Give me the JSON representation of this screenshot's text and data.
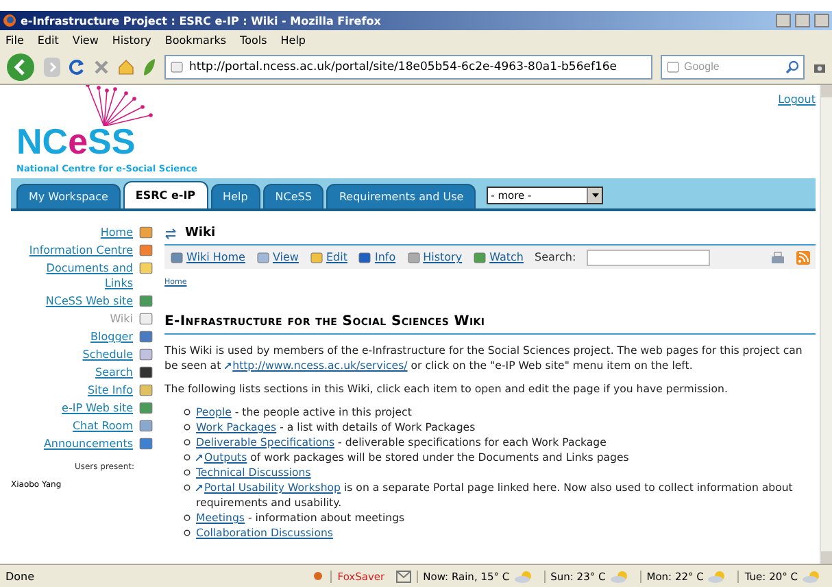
{
  "window": {
    "title": "e-Infrastructure Project : ESRC e-IP : Wiki - Mozilla Firefox"
  },
  "menu": [
    "File",
    "Edit",
    "View",
    "History",
    "Bookmarks",
    "Tools",
    "Help"
  ],
  "nav": {
    "url": "http://portal.ncess.ac.uk/portal/site/18e05b54-6c2e-4963-80a1-b56ef16e",
    "search": {
      "placeholder": "Google"
    }
  },
  "header": {
    "logout": "Logout",
    "logo": [
      {
        "text": "NC",
        "color": "#1aa6dc"
      },
      {
        "text": "e",
        "color": "#d21b82"
      },
      {
        "text": "SS",
        "color": "#1aa6dc"
      }
    ],
    "tagline": "National Centre for e-Social Science"
  },
  "tabs": [
    {
      "label": "My Workspace",
      "selected": false
    },
    {
      "label": "ESRC e-IP",
      "selected": true
    },
    {
      "label": "Help",
      "selected": false
    },
    {
      "label": "NCeSS",
      "selected": false
    },
    {
      "label": "Requirements and Use",
      "selected": false
    }
  ],
  "more": {
    "value": "- more -"
  },
  "sidebar": {
    "items": [
      {
        "label": "Home",
        "selected": false
      },
      {
        "label": "Information Centre",
        "selected": false
      },
      {
        "label": "Documents and Links",
        "selected": false
      },
      {
        "label": "NCeSS Web site",
        "selected": false
      },
      {
        "label": "Wiki",
        "selected": true
      },
      {
        "label": "Blogger",
        "selected": false
      },
      {
        "label": "Schedule",
        "selected": false
      },
      {
        "label": "Search",
        "selected": false
      },
      {
        "label": "Site Info",
        "selected": false
      },
      {
        "label": "e-IP Web site",
        "selected": false
      },
      {
        "label": "Chat Room",
        "selected": false
      },
      {
        "label": "Announcements",
        "selected": false
      }
    ],
    "users_label": "Users present:",
    "users": [
      "Xiaobo Yang"
    ]
  },
  "wiki": {
    "title": "Wiki",
    "toolbar": [
      "Wiki Home",
      "View",
      "Edit",
      "Info",
      "History",
      "Watch"
    ],
    "search_label": "Search:",
    "breadcrumb": "Home",
    "heading": "E-Infrastructure for the Social Sciences Wiki",
    "intro": {
      "before": "This Wiki is used by members of the e-Infrastructure for the Social Sciences project. The web pages for this project can be seen at ",
      "link": "http://www.ncess.ac.uk/services/",
      "after": " or click on the \"e-IP Web site\" menu item on the left."
    },
    "lead": "The following lists sections in this Wiki, click each item to open and edit the page if you have permission.",
    "items": [
      {
        "link": "People",
        "text": " - the people active in this project",
        "external": false
      },
      {
        "link": "Work Packages",
        "text": " - a list with details of Work Packages",
        "external": false
      },
      {
        "link": "Deliverable Specifications",
        "text": " - deliverable specifications for each Work Package",
        "external": false
      },
      {
        "link": "Outputs",
        "text": " of work packages will be stored under the Documents and Links pages",
        "external": true
      },
      {
        "link": "Technical Discussions",
        "external": false
      },
      {
        "link": "Portal Usability Workshop",
        "text": " is on a separate Portal page linked here. Now also used to collect information about requirements and usability.",
        "external": true
      },
      {
        "link": "Meetings",
        "text": " - information about meetings",
        "external": false
      },
      {
        "link": "Collaboration Discussions",
        "external": false
      }
    ]
  },
  "status": {
    "text": "Done",
    "foxsaver": "FoxSaver",
    "weather": [
      "Now: Rain, 15° C",
      "Sun: 23° C",
      "Mon: 22° C",
      "Tue: 20° C"
    ]
  }
}
